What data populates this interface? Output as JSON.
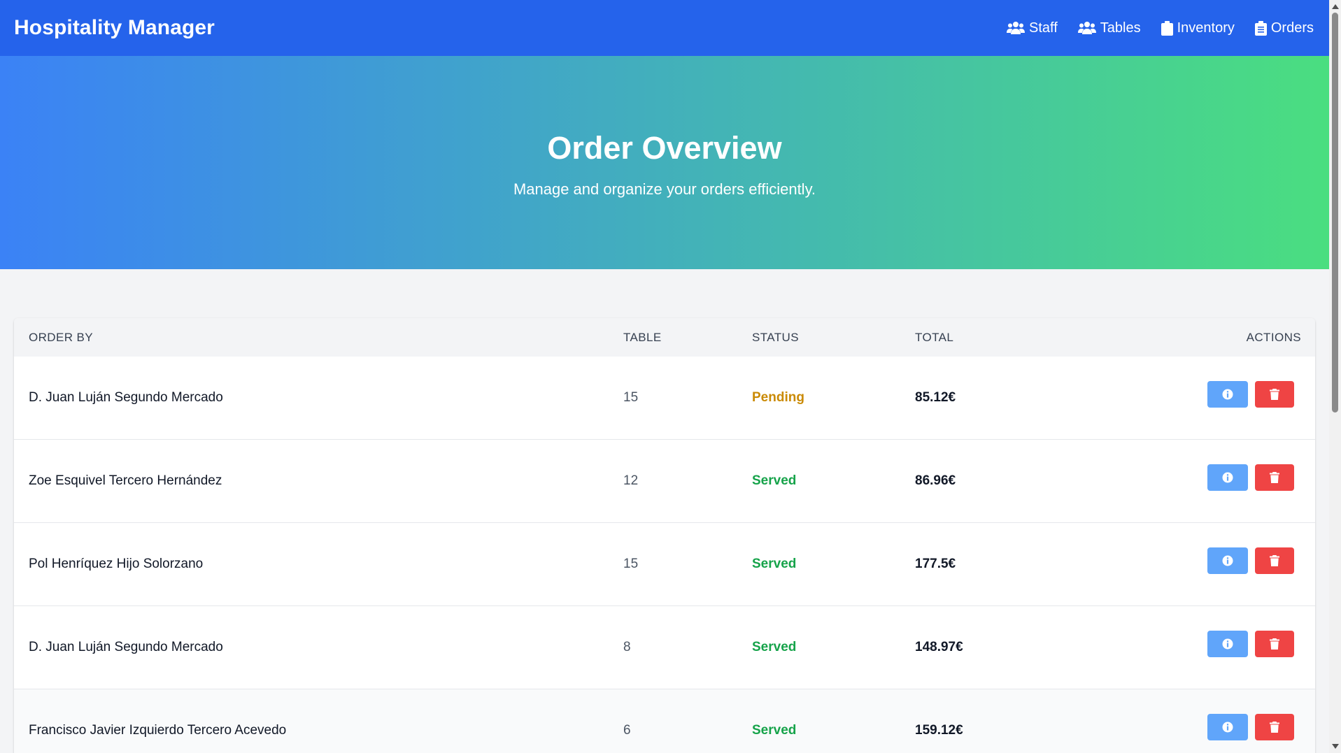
{
  "app": {
    "title": "Hospitality Manager"
  },
  "nav": {
    "items": [
      {
        "label": "Staff",
        "icon": "users-icon"
      },
      {
        "label": "Tables",
        "icon": "users-icon"
      },
      {
        "label": "Inventory",
        "icon": "clipboard-icon"
      },
      {
        "label": "Orders",
        "icon": "clipboard-list-icon"
      }
    ]
  },
  "hero": {
    "title": "Order Overview",
    "subtitle": "Manage and organize your orders efficiently."
  },
  "table": {
    "headers": {
      "order_by": "ORDER BY",
      "table": "TABLE",
      "status": "STATUS",
      "total": "TOTAL",
      "actions": "ACTIONS"
    },
    "rows": [
      {
        "order_by": "D. Juan Luján Segundo Mercado",
        "table": "15",
        "status": "Pending",
        "total": "85.12€"
      },
      {
        "order_by": "Zoe Esquivel Tercero Hernández",
        "table": "12",
        "status": "Served",
        "total": "86.96€"
      },
      {
        "order_by": "Pol Henríquez Hijo Solorzano",
        "table": "15",
        "status": "Served",
        "total": "177.5€"
      },
      {
        "order_by": "D. Juan Luján Segundo Mercado",
        "table": "8",
        "status": "Served",
        "total": "148.97€"
      },
      {
        "order_by": "Francisco Javier Izquierdo Tercero Acevedo",
        "table": "6",
        "status": "Served",
        "total": "159.12€"
      }
    ]
  },
  "colors": {
    "navbar": "#2563eb",
    "hero_gradient_start": "#3b82f6",
    "hero_gradient_end": "#4ade80",
    "pending": "#ca8a04",
    "served": "#16a34a",
    "info_button": "#60a5fa",
    "delete_button": "#ef4444"
  }
}
